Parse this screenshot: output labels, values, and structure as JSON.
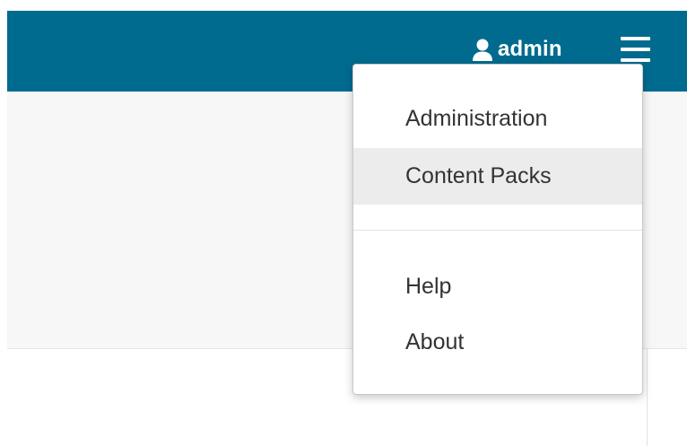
{
  "header": {
    "user": {
      "name": "admin",
      "icon": "user-icon"
    },
    "menu_icon": "hamburger-menu-icon",
    "bar_color": "#006b8f"
  },
  "dropdown": {
    "items": [
      {
        "label": "Administration",
        "active": false
      },
      {
        "label": "Content Packs",
        "active": true
      }
    ],
    "secondary_items": [
      {
        "label": "Help"
      },
      {
        "label": "About"
      }
    ],
    "hover_color": "#ececec"
  }
}
